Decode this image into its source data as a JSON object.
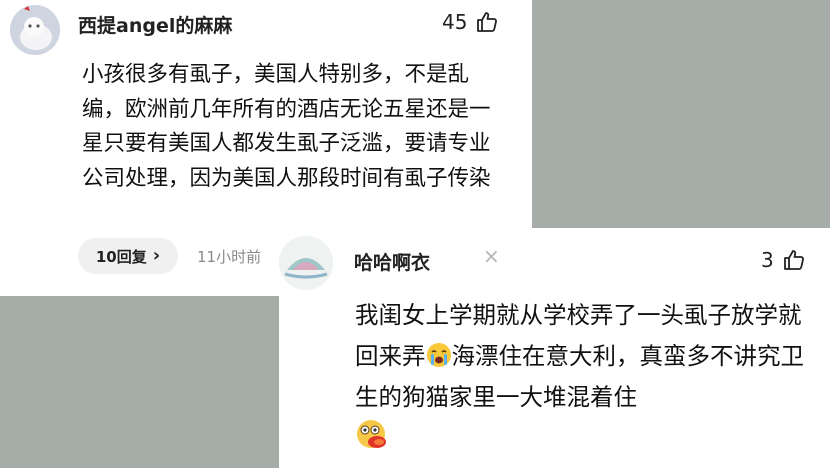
{
  "comment1": {
    "username": "西提angel的麻麻",
    "like_count": "45",
    "text": "小孩很多有虱子，美国人特别多，不是乱编，欧洲前几年所有的酒店无论五星还是一星只要有美国人都发生虱子泛滥，要请专业公司处理，因为美国人那段时间有虱子传染",
    "reply_label": "10回复",
    "reply_chevron": "›",
    "timestamp": "11小时前",
    "like_icon": "thumbs-up-icon",
    "avatar_icon": "cat-avatar"
  },
  "comment2": {
    "username": "哈哈啊衣",
    "close_glyph": "×",
    "like_count": "3",
    "text_part1": "我闺女上学期就从学校弄了一头虱子放学就回来弄",
    "emoji1": "crying-face-emoji",
    "text_part2": "海漂住在意大利，真蛮多不讲究卫生的狗猫家里一大堆混着住",
    "emoji2": "vomiting-face-emoji",
    "like_icon": "thumbs-up-icon",
    "avatar_icon": "lotus-logo-avatar"
  },
  "colors": {
    "background_gray": "#a6aca8",
    "card_white": "#ffffff",
    "text_dark": "#111111",
    "timestamp_gray": "#8a8a8a",
    "reply_button_bg": "#f0f0f0"
  }
}
